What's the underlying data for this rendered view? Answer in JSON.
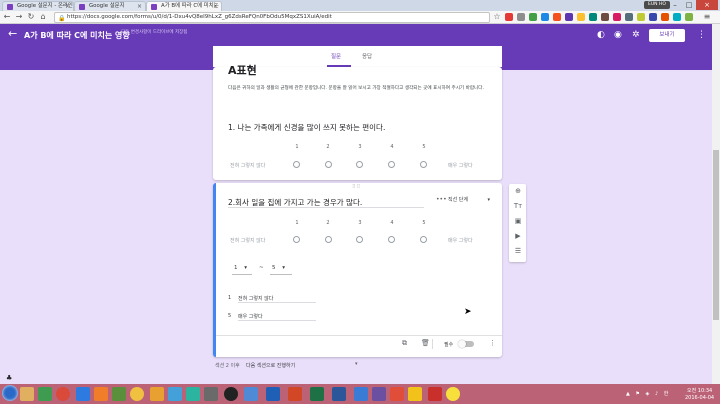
{
  "browser": {
    "tabs": [
      {
        "label": "Google 설문지 - 온라인"
      },
      {
        "label": "Google 설문지"
      },
      {
        "label": "A가 B에 따라 C에 미치는"
      }
    ],
    "user_chip": "EUN HO",
    "url": "https://docs.google.com/forms/u/0/d/1-Dxu4vQ8eI9hLxZ_g6ZdsReFQn0FbOdu5MqxZS1XuiA/edit"
  },
  "header": {
    "title": "A가 B에 따라 C에 미치는 영향",
    "saved_note": "모든 변경사항이 드라이브에 저장됨",
    "send_label": "보내기"
  },
  "tabs": {
    "questions": "질문",
    "responses": "응답"
  },
  "section": {
    "title": "A표현",
    "description": "다음은 귀하의 일과 생활의 균형에 관한 문항입니다. 문항을 잘 읽어 보시고 가장 적절하다고 생각되는 곳에 표시하여 주시기 바랍니다."
  },
  "question1": {
    "title": "1. 나는 가족에게 신경을 많이 쓰지 못하는 편이다.",
    "scale": [
      "1",
      "2",
      "3",
      "4",
      "5"
    ],
    "min_label": "전혀 그렇지 않다",
    "max_label": "매우 그렇다"
  },
  "question2": {
    "title": "2.회사 일을 집에 가지고 가는 경우가 많다.",
    "type_label": "직선 단계",
    "scale": [
      "1",
      "2",
      "3",
      "4",
      "5"
    ],
    "min_label": "전혀 그렇지 않다",
    "max_label": "매우 그렇다",
    "range_min": "1",
    "range_sep": "~",
    "range_max": "5",
    "label_rows": [
      {
        "num": "1",
        "text": "전혀 그렇지 않다"
      },
      {
        "num": "5",
        "text": "매우 그렇다"
      }
    ],
    "required_label": "필수"
  },
  "after_section": {
    "label": "섹션 2 이후",
    "value": "다음 섹션으로 진행하기"
  },
  "taskbar": {
    "time": "오전 10:34",
    "date": "2016-04-04"
  },
  "colors": {
    "accent": "#673ab7",
    "background": "#eadffb",
    "active_border": "#4285f4",
    "taskbar": "#bc6276"
  }
}
